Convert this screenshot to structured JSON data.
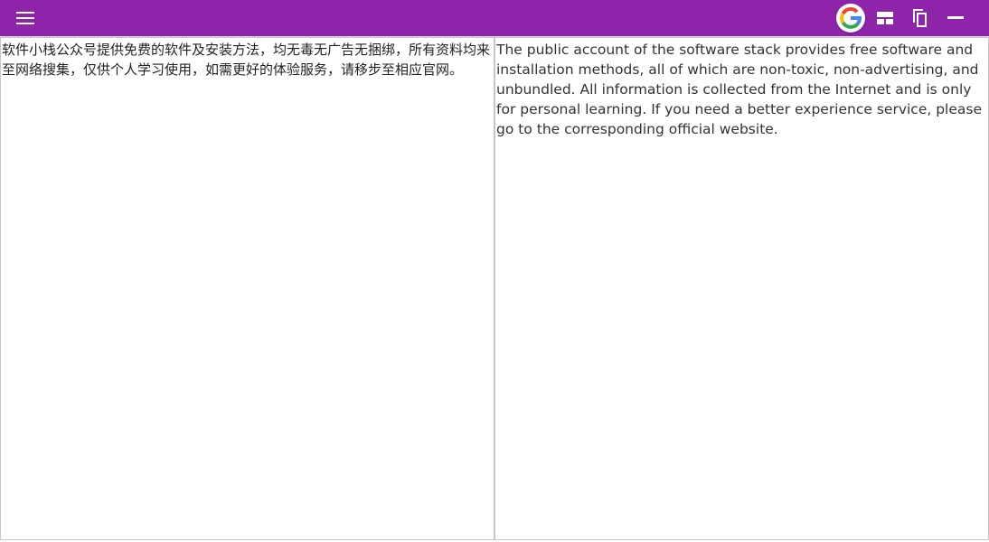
{
  "topbar": {
    "background": "#8e24aa",
    "menu_icon": "hamburger-menu-icon",
    "translate_icon": "google-translate-icon",
    "layout_icon": "layout-grid-icon",
    "copy_icon": "copy-icon",
    "minimize_icon": "minimize-icon"
  },
  "panes": {
    "source_text": "软件小栈公众号提供免费的软件及安装方法，均无毒无广告无捆绑，所有资料均来至网络搜集，仅供个人学习使用，如需更好的体验服务，请移步至相应官网。",
    "target_text": "The public account of the software stack provides free software and installation methods, all of which are non-toxic, non-advertising, and unbundled. All information is collected from the Internet and is only for personal learning. If you need a better experience service, please go to the corresponding official website."
  }
}
